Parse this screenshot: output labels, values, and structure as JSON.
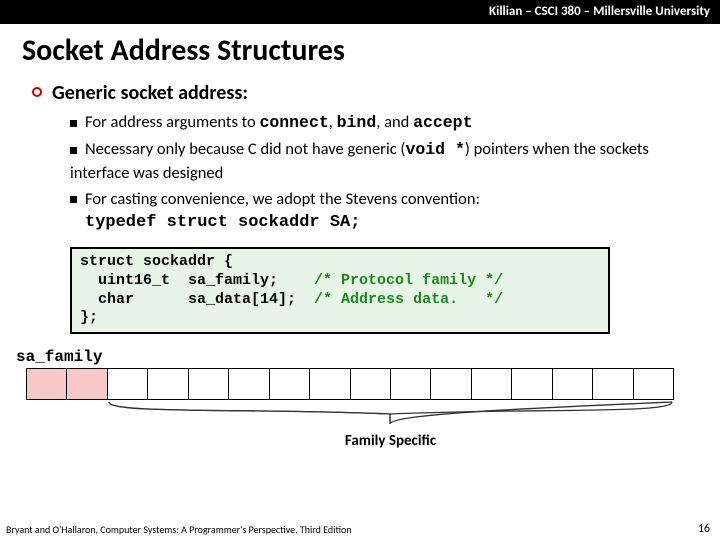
{
  "header": "Killian – CSCI 380 – Millersville University",
  "title": "Socket Address Structures",
  "l1": "Generic socket address:",
  "b1a": "For address arguments to ",
  "b1b": ", ",
  "b1c": ", and ",
  "c_connect": "connect",
  "c_bind": "bind",
  "c_accept": "accept",
  "b2a": "Necessary only because C did not have generic (",
  "c_voidp": "void *",
  "b2b": ") pointers when the sockets interface was designed",
  "b3a": "For casting convenience, we adopt the Stevens convention:",
  "c_typedef": "typedef struct sockaddr SA;",
  "code_l1": "struct sockaddr {",
  "code_l2a": "  uint16_t  sa_family;    ",
  "code_l2c": "/* Protocol family */",
  "code_l3a": "  char      sa_data[14];  ",
  "code_l3c": "/* Address data.   */",
  "code_l4": "};",
  "sa_family": "sa_family",
  "family_specific": "Family Specific",
  "footer": "Bryant and O'Hallaron, Computer Systems: A Programmer's Perspective, Third Edition",
  "slidenum": "16"
}
